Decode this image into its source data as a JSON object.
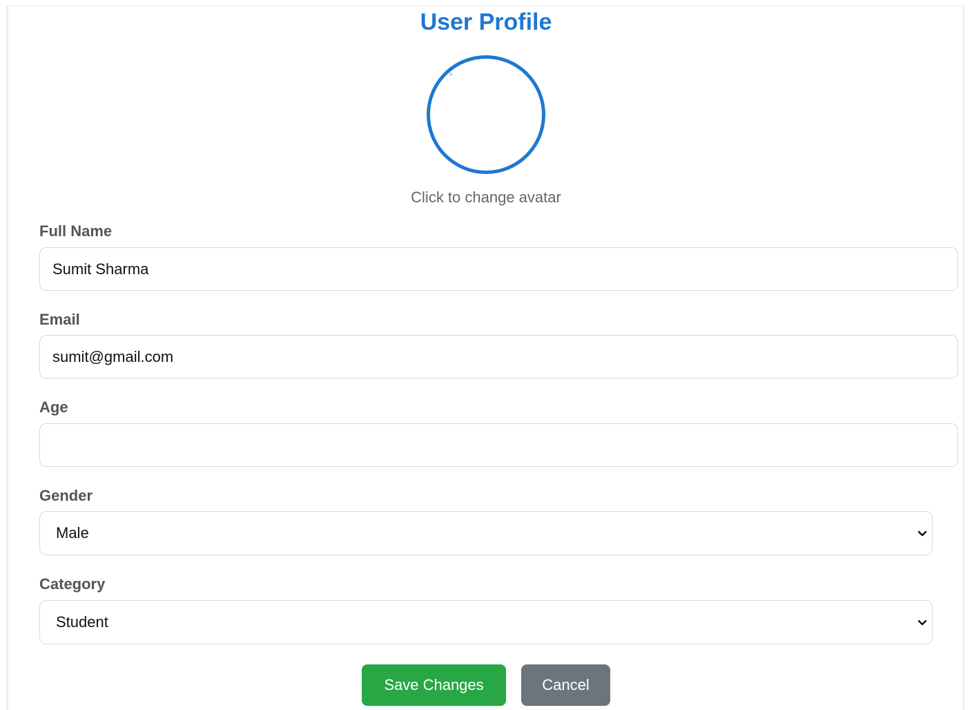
{
  "page": {
    "title": "User Profile",
    "avatar_hint": "Click to change avatar"
  },
  "form": {
    "full_name": {
      "label": "Full Name",
      "value": "Sumit Sharma",
      "placeholder": ""
    },
    "email": {
      "label": "Email",
      "value": "sumit@gmail.com",
      "placeholder": ""
    },
    "age": {
      "label": "Age",
      "value": "",
      "placeholder": ""
    },
    "gender": {
      "label": "Gender",
      "selected": "Male"
    },
    "category": {
      "label": "Category",
      "selected": "Student"
    }
  },
  "actions": {
    "save_label": "Save Changes",
    "cancel_label": "Cancel"
  },
  "colors": {
    "accent": "#1f78d1",
    "save": "#28a745",
    "cancel": "#6c757d"
  },
  "icons": {
    "avatar": "avatar-circle-icon",
    "select_arrow": "chevron-down-icon"
  }
}
